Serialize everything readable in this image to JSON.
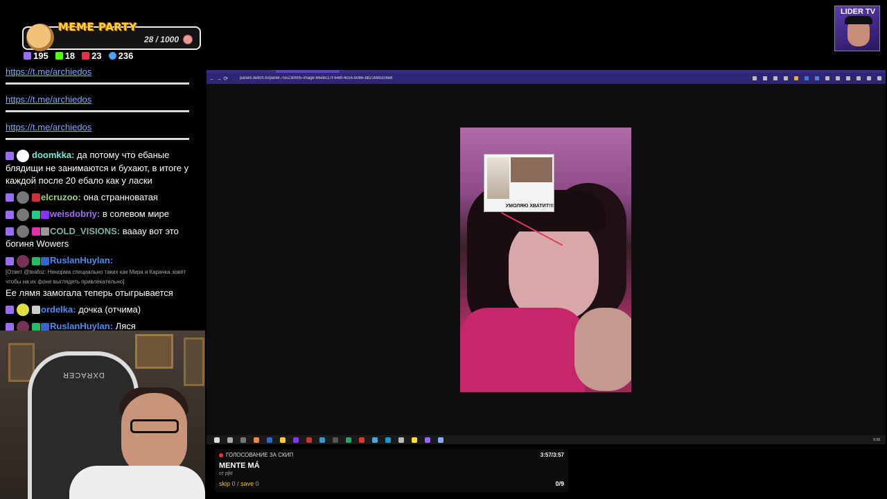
{
  "meme_party": {
    "title": "MEME PARTY",
    "progress": "28 / 1000"
  },
  "stats": [
    {
      "icon": "twitch-icon",
      "value": "195",
      "color": "#9b6df2"
    },
    {
      "icon": "kick-icon",
      "value": "18",
      "color": "#53fc18"
    },
    {
      "icon": "live-icon",
      "value": "23",
      "color": "#e0334a"
    },
    {
      "icon": "viewers-icon",
      "value": "236",
      "color": "#4aa3ff"
    }
  ],
  "chat": {
    "links": [
      "https://t.me/archiedos",
      "https://t.me/archiedos",
      "https://t.me/archiedos"
    ],
    "messages": [
      {
        "user": "doomkka",
        "color": "#6ef0d8",
        "text": "да потому что ебаные блядищи не занимаются и бухают, в итоге у каждой после 20 ебало как у ласки"
      },
      {
        "user": "elcruzoo",
        "color": "#9ad07a",
        "text": "она странноватая"
      },
      {
        "user": "weisdobriy",
        "color": "#a36bf2",
        "text": "в солевом мире"
      },
      {
        "user": "COLD_VISIONS",
        "color": "#7fb3a0",
        "text": "вааау вот это богиня Wowers"
      },
      {
        "user": "RuslanHuylan",
        "color": "#4a8cf0",
        "text": "",
        "reply": "[Ответ @teafoz: Ненорма специально таких как Мира и Карачка зовёт чтобы на их фоне выглядеть привлекательно]",
        "after": "Ее лямя замогала теперь отыгрывается"
      },
      {
        "user": "ordelka",
        "color": "#4a8cf0",
        "text": "дочка (отчима)"
      },
      {
        "user": "RuslanHuylan",
        "color": "#4a8cf0",
        "text": "Ляся"
      }
    ]
  },
  "webcam": {
    "chair_brand": "DXRACER"
  },
  "channel_badge": {
    "title": "LIDER TV"
  },
  "browser": {
    "url": "panels.twitch.tv/panel-755230905-image-b6ebc17f-648f-4c55-b0b6-bb2169b108e8",
    "nav": "← → ⟳",
    "photo_caption": "УМОЛЯЮ ХВАТИТ!!!",
    "clock": "5:08"
  },
  "vote": {
    "header": "ГОЛОСОВАНИЕ ЗА СКИП",
    "time": "3:57/3:57",
    "song": "MENTE MÁ",
    "from": "от pjkt",
    "skip_label": "skip",
    "skip_count": "0",
    "save_label": "save",
    "save_count": "0",
    "tally": "0/9"
  }
}
